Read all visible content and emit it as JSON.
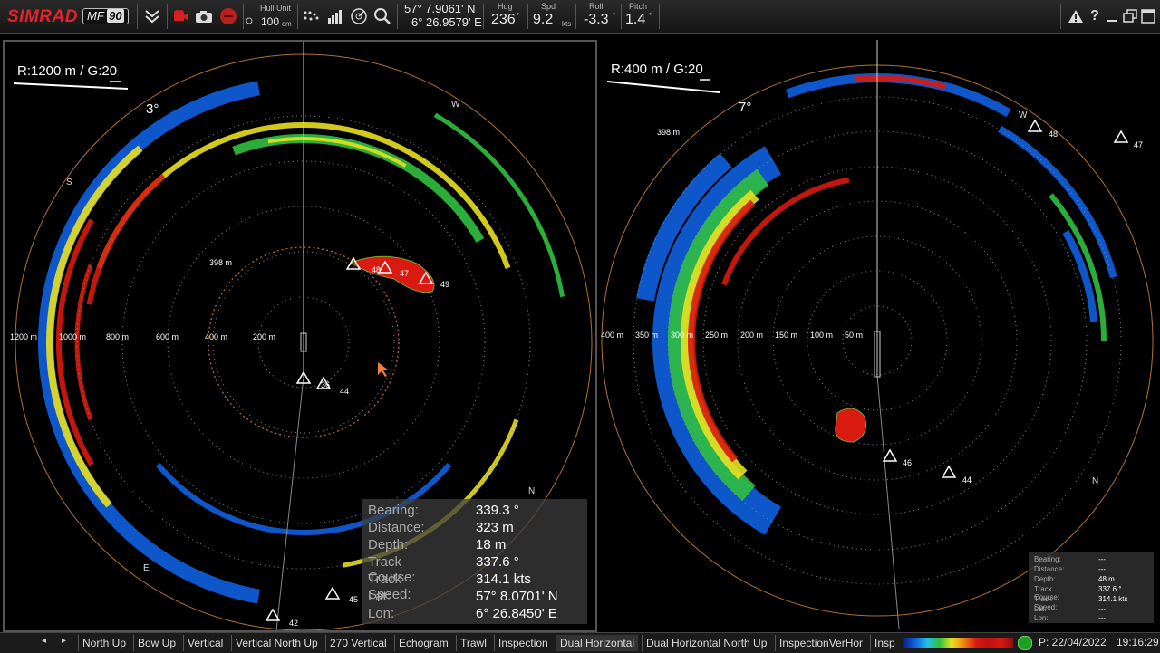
{
  "topbar": {
    "logo": "SIMRAD",
    "model": "MF",
    "model_num": "90",
    "hull_unit_label": "Hull Unit",
    "hull_unit_value": "100",
    "hull_unit_unit": "cm",
    "lat": "57° 7.9061' N",
    "lon": "6° 26.9579' E",
    "hdg_label": "Hdg",
    "hdg_value": "236",
    "spd_label": "Spd",
    "spd_value": "9.2",
    "spd_unit": "kts",
    "roll_label": "Roll",
    "roll_value": "-3.3",
    "pitch_label": "Pitch",
    "pitch_value": "1.4"
  },
  "left_panel": {
    "range_gain": "R:1200 m  / G:20",
    "tilt": "3°",
    "ring_labels": [
      "1200 m",
      "1000 m",
      "800 m",
      "600 m",
      "400 m",
      "200 m"
    ],
    "marker_label": "398 m",
    "compass": {
      "W": "W",
      "S": "S",
      "N": "N",
      "E": "E"
    },
    "targets": [
      "48",
      "47",
      "49",
      "36",
      "44",
      "45",
      "42"
    ],
    "info": {
      "bearing_k": "Bearing:",
      "bearing_v": "339.3 °",
      "distance_k": "Distance:",
      "distance_v": "323 m",
      "depth_k": "Depth:",
      "depth_v": "18 m",
      "course_k": "Track Course:",
      "course_v": "337.6 °",
      "speed_k": "Track Speed:",
      "speed_v": "314.1 kts",
      "lat_k": "Lat:",
      "lat_v": "57° 8.0701' N",
      "lon_k": "Lon:",
      "lon_v": "6° 26.8450' E"
    }
  },
  "right_panel": {
    "range_gain": "R:400 m  / G:20",
    "tilt": "7°",
    "ring_labels": [
      "400 m",
      "350 m",
      "300 m",
      "250 m",
      "200 m",
      "150 m",
      "100 m",
      "50 m"
    ],
    "marker_label": "398 m",
    "compass": {
      "W": "W",
      "N": "N"
    },
    "targets": [
      "48",
      "47",
      "46",
      "44"
    ],
    "info": {
      "bearing_k": "Bearing:",
      "bearing_v": "---",
      "distance_k": "Distance:",
      "distance_v": "---",
      "depth_k": "Depth:",
      "depth_v": "48 m",
      "course_k": "Track Course:",
      "course_v": "337.6 °",
      "speed_k": "Track Speed:",
      "speed_v": "314.1 kts",
      "lat_k": "Lat:",
      "lat_v": "---",
      "lon_k": "Lon:",
      "lon_v": "---"
    }
  },
  "bottombar": {
    "tabs": [
      "North Up",
      "Bow Up",
      "Vertical",
      "Vertical North Up",
      "270 Vertical",
      "Echogram",
      "Trawl",
      "Inspection",
      "Dual Horizontal",
      "Dual Horizontal North Up",
      "InspectionVerHor",
      "Insp"
    ],
    "active_tab": "Dual Horizontal",
    "status": "P: 22/04/2022",
    "time": "19:16:29"
  },
  "colors": {
    "brand": "#e3232c",
    "echo_red": "#d81a10",
    "echo_yellow": "#e8e020",
    "echo_green": "#30c040",
    "echo_blue": "#1060e0"
  }
}
